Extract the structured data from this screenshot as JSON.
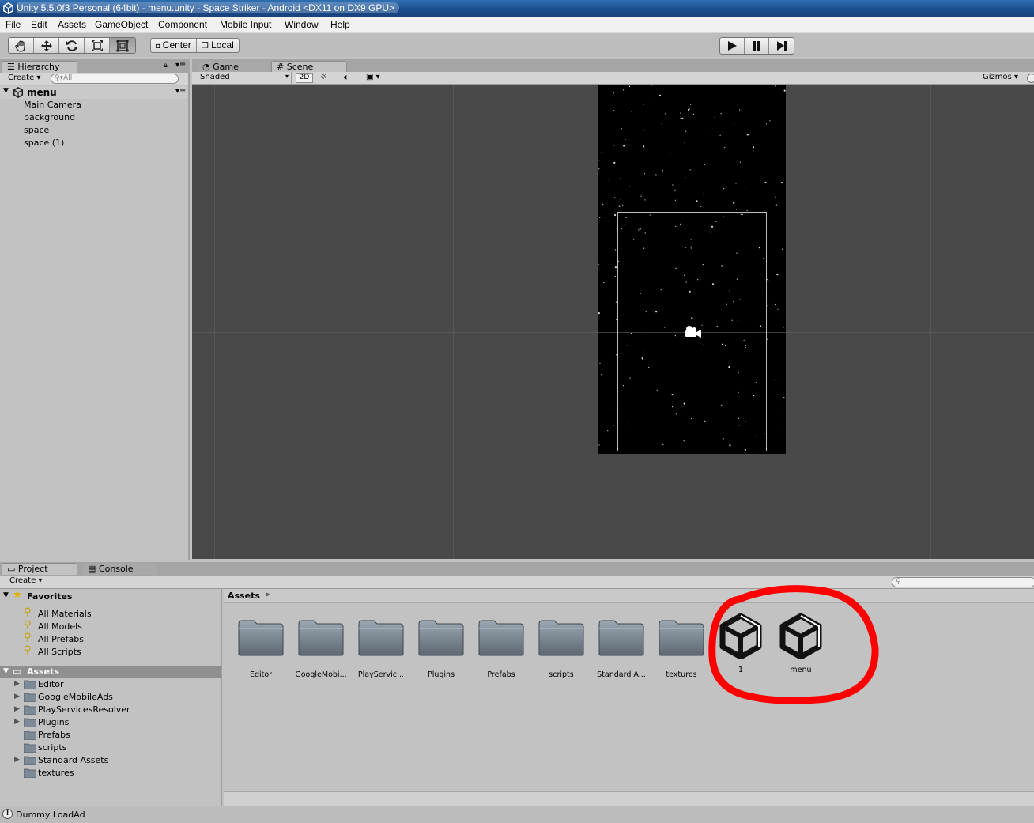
{
  "window": {
    "title": "Unity 5.5.0f3 Personal (64bit) - menu.unity - Space Striker - Android <DX11 on DX9 GPU>"
  },
  "menu": [
    "File",
    "Edit",
    "Assets",
    "GameObject",
    "Component",
    "Mobile Input",
    "Window",
    "Help"
  ],
  "toolbar": {
    "tools": [
      "hand-tool-icon",
      "move-tool-icon",
      "rotate-tool-icon",
      "scale-tool-icon",
      "rect-tool-icon"
    ],
    "pivot_center": "Center",
    "pivot_local": "Local"
  },
  "hierarchy": {
    "tab": "Hierarchy",
    "create": "Create",
    "search_placeholder": "All",
    "scene_name": "menu",
    "items": [
      "Main Camera",
      "background",
      "space",
      "space (1)"
    ]
  },
  "scene_view": {
    "tab_game": "Game",
    "tab_scene": "Scene",
    "shading": "Shaded",
    "mode_2d": "2D",
    "gizmos": "Gizmos"
  },
  "project": {
    "tab_project": "Project",
    "tab_console": "Console",
    "create": "Create",
    "favorites_label": "Favorites",
    "favorites": [
      "All Materials",
      "All Models",
      "All Prefabs",
      "All Scripts"
    ],
    "assets_label": "Assets",
    "tree": [
      "Editor",
      "GoogleMobileAds",
      "PlayServicesResolver",
      "Plugins",
      "Prefabs",
      "scripts",
      "Standard Assets",
      "textures"
    ],
    "breadcrumb": "Assets",
    "grid": [
      "Editor",
      "GoogleMobi...",
      "PlayServic...",
      "Plugins",
      "Prefabs",
      "scripts",
      "Standard A...",
      "textures",
      "1",
      "menu"
    ]
  },
  "status": {
    "message": "Dummy LoadAd"
  },
  "colors": {
    "highlight_circle": "#ff0000",
    "scene_bg": "#494949"
  }
}
